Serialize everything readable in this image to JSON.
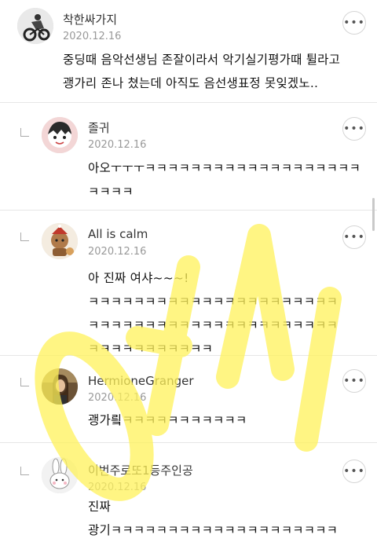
{
  "comments": [
    {
      "author": "착한싸가지",
      "date": "2020.12.16",
      "text": "중딩때 음악선생님 존잘이라서 악기실기평가때 튈라고\n괭가리 존나 쳤는데 아직도 음선생표정 못잊겠노..",
      "more_icon": "more-horizontal-icon"
    },
    {
      "author": "졸귀",
      "date": "2020.12.16",
      "text": "아오ㅜㅜㅜㅋㅋㅋㅋㅋㅋㅋㅋㅋㅋㅋㅋㅋㅋㅋㅋㅋㅋㅋ\nㅋㅋㅋㅋ",
      "more_icon": "more-horizontal-icon"
    },
    {
      "author": "All is calm",
      "date": "2020.12.16",
      "text": "아 진짜 여샤~~~!\nㅋㅋㅋㅋㅋㅋㅋㅋㅋㅋㅋㅋㅋㅋㅋㅋㅋㅋㅋㅋㅋㅋ\nㅋㅋㅋㅋㅋㅋㅋㅋㅋㅋㅋㅋㅋㅋㅋㅋㅋㅋㅋㅋㅋㅋ\nㅋㅋㅋㅋㅋㅋㅋㅋㅋㅋㅋ",
      "more_icon": "more-horizontal-icon"
    },
    {
      "author": "HermioneGranger",
      "date": "2020.12.16",
      "text": "괭가릨ㅋㅋㅋㅋㅋㅋㅋㅋㅋㅋㅋ",
      "more_icon": "more-horizontal-icon"
    },
    {
      "author": "이번주로또1등주인공",
      "date": "2020.12.16",
      "text": "진짜\n광기ㅋㅋㅋㅋㅋㅋㅋㅋㅋㅋㅋㅋㅋㅋㅋㅋㅋㅋㅋㅋ",
      "more_icon": "more-horizontal-icon"
    }
  ],
  "more_label": "•••",
  "watermark": {
    "text": "여시",
    "color": "#fff25a"
  }
}
